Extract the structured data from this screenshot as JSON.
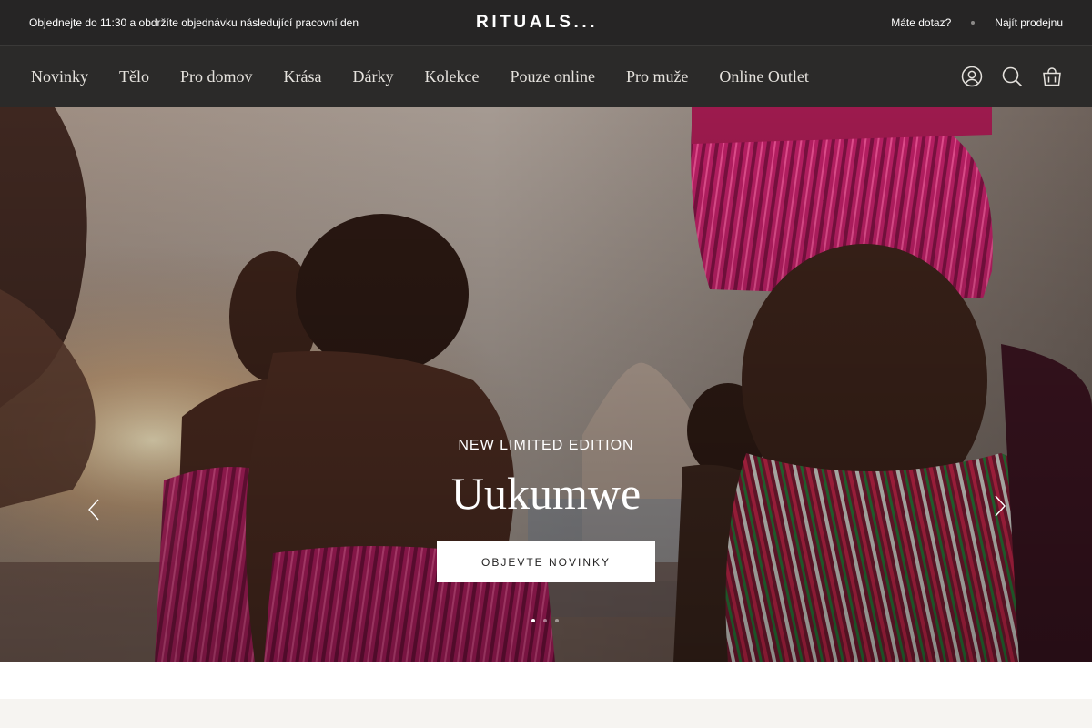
{
  "topbar": {
    "promo": "Objednejte do 11:30 a obdržíte objednávku následující pracovní den",
    "logo": "RITUALS...",
    "help_links": [
      {
        "label": "Máte dotaz?"
      },
      {
        "label": "Najít prodejnu"
      }
    ]
  },
  "nav": {
    "items": [
      {
        "label": "Novinky"
      },
      {
        "label": "Tělo"
      },
      {
        "label": "Pro domov"
      },
      {
        "label": "Krása"
      },
      {
        "label": "Dárky"
      },
      {
        "label": "Kolekce"
      },
      {
        "label": "Pouze online"
      },
      {
        "label": "Pro muže"
      },
      {
        "label": "Online Outlet"
      }
    ],
    "icons": [
      "account-icon",
      "search-icon",
      "shopping-bag-icon"
    ]
  },
  "hero": {
    "eyebrow": "NEW LIMITED EDITION",
    "headline": "Uukumwe",
    "cta_label": "OBJEVTE NOVINKY",
    "slide_count": 3,
    "active_slide": 1
  },
  "colors": {
    "topbar_bg": "#262525",
    "nav_bg": "#2b2a29",
    "accent_magenta": "#c2246e",
    "cta_bg": "#ffffff",
    "footer_strip": "#f6f4f1"
  }
}
